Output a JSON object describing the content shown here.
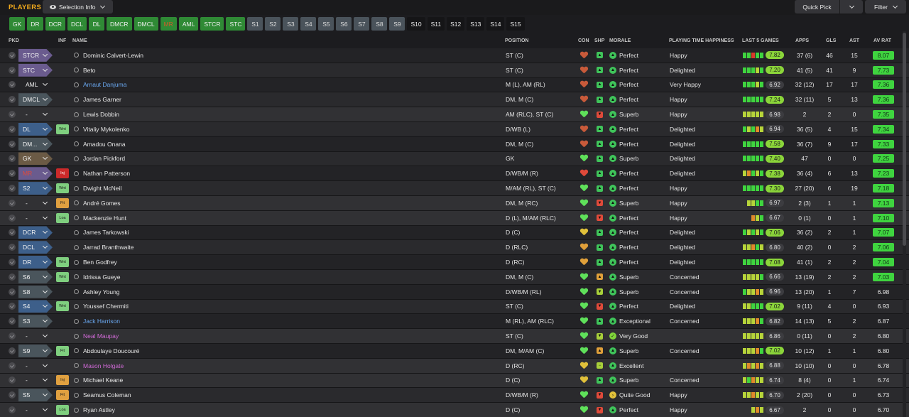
{
  "header": {
    "title": "PLAYERS",
    "selection_info": "Selection Info",
    "quick_pick": "Quick Pick",
    "filter": "Filter"
  },
  "positions": [
    {
      "label": "GK",
      "style": "green"
    },
    {
      "label": "DR",
      "style": "green"
    },
    {
      "label": "DCR",
      "style": "green"
    },
    {
      "label": "DCL",
      "style": "green"
    },
    {
      "label": "DL",
      "style": "green"
    },
    {
      "label": "DMCR",
      "style": "green"
    },
    {
      "label": "DMCL",
      "style": "green"
    },
    {
      "label": "MR",
      "style": "empty"
    },
    {
      "label": "AML",
      "style": "green"
    },
    {
      "label": "STCR",
      "style": "green"
    },
    {
      "label": "STC",
      "style": "green"
    },
    {
      "label": "S1",
      "style": "grey"
    },
    {
      "label": "S2",
      "style": "grey"
    },
    {
      "label": "S3",
      "style": "grey"
    },
    {
      "label": "S4",
      "style": "grey"
    },
    {
      "label": "S5",
      "style": "grey"
    },
    {
      "label": "S6",
      "style": "grey"
    },
    {
      "label": "S7",
      "style": "grey"
    },
    {
      "label": "S8",
      "style": "grey"
    },
    {
      "label": "S9",
      "style": "grey"
    },
    {
      "label": "S10",
      "style": "dark"
    },
    {
      "label": "S11",
      "style": "dark"
    },
    {
      "label": "S12",
      "style": "dark"
    },
    {
      "label": "S13",
      "style": "dark"
    },
    {
      "label": "S14",
      "style": "dark"
    },
    {
      "label": "S15",
      "style": "dark"
    }
  ],
  "columns": {
    "pkd": "PKD",
    "inf": "INF",
    "name": "NAME",
    "position": "POSITION",
    "con": "CON",
    "shp": "SHP",
    "morale": "MORALE",
    "playing_time": "PLAYING TIME HAPPINESS",
    "last5": "LAST 5 GAMES",
    "apps": "APPS",
    "gls": "GLS",
    "ast": "AST",
    "av_rat": "AV RAT"
  },
  "colors": {
    "accent": "#f0a91c",
    "good": "#3fd43f",
    "name_link": "#6aa8f0",
    "name_loan": "#d06ad6"
  },
  "players": [
    {
      "slot": "STCR",
      "slot_color": "#6a5b8e",
      "inf": "",
      "name": "Dominic Calvert-Lewin",
      "name_color": "",
      "pos": "ST (C)",
      "con": "#c85a3a",
      "shp": "#3fc45a",
      "shp_mark": "▲",
      "morale_color": "#3fc45a",
      "morale_mark": "▲",
      "morale": "Perfect",
      "pt": "Happy",
      "l5": "ggrgg",
      "l5_rating": "7.82",
      "l5_good": true,
      "apps": "37 (6)",
      "gls": "46",
      "ast": "15",
      "av": "8.07",
      "av_good": true
    },
    {
      "slot": "STC",
      "slot_color": "#6a5b8e",
      "inf": "",
      "name": "Beto",
      "name_color": "",
      "pos": "ST (C)",
      "con": "#c85a3a",
      "shp": "#3fc45a",
      "shp_mark": "▲",
      "morale_color": "#3fc45a",
      "morale_mark": "▲",
      "morale": "Perfect",
      "pt": "Delighted",
      "l5": "gggyg",
      "l5_rating": "7.20",
      "l5_good": true,
      "apps": "41 (5)",
      "gls": "41",
      "ast": "9",
      "av": "7.73",
      "av_good": true
    },
    {
      "slot": "AML",
      "slot_color": "",
      "inf": "",
      "name": "Arnaut Danjuma",
      "name_color": "#6aa8f0",
      "pos": "M (L), AM (RL)",
      "con": "#c85a3a",
      "shp": "#3fc45a",
      "shp_mark": "▲",
      "morale_color": "#3fc45a",
      "morale_mark": "▲",
      "morale": "Perfect",
      "pt": "Very Happy",
      "l5": "gggyg",
      "l5_rating": "6.92",
      "l5_good": false,
      "apps": "32 (12)",
      "gls": "17",
      "ast": "17",
      "av": "7.36",
      "av_good": true
    },
    {
      "slot": "DMCL",
      "slot_color": "#4a555c",
      "inf": "",
      "name": "James Garner",
      "name_color": "",
      "pos": "DM, M (C)",
      "con": "#c85a3a",
      "shp": "#3fc45a",
      "shp_mark": "▲",
      "morale_color": "#3fc45a",
      "morale_mark": "▲",
      "morale": "Perfect",
      "pt": "Happy",
      "l5": "ggggg",
      "l5_rating": "7.24",
      "l5_good": true,
      "apps": "32 (11)",
      "gls": "5",
      "ast": "13",
      "av": "7.36",
      "av_good": true
    },
    {
      "slot": "-",
      "slot_color": "",
      "inf": "",
      "name": "Lewis Dobbin",
      "name_color": "",
      "pos": "AM (RLC), ST (C)",
      "con": "#5fe05a",
      "shp": "#e04a3a",
      "shp_mark": "▼",
      "morale_color": "#3fc45a",
      "morale_mark": "▲",
      "morale": "Superb",
      "pt": "Happy",
      "l5": "yyyyy",
      "l5_rating": "6.98",
      "l5_good": false,
      "apps": "2",
      "gls": "2",
      "ast": "0",
      "av": "7.35",
      "av_good": true
    },
    {
      "slot": "DL",
      "slot_color": "#3d5f8a",
      "inf": "Wnt",
      "inf_color": "#7fcf7f",
      "name": "Vitaliy Mykolenko",
      "name_color": "",
      "pos": "D/WB (L)",
      "con": "#c85a3a",
      "shp": "#3fc45a",
      "shp_mark": "▲",
      "morale_color": "#3fc45a",
      "morale_mark": "▲",
      "morale": "Perfect",
      "pt": "Delighted",
      "l5": "gygoy",
      "l5_rating": "6.94",
      "l5_good": false,
      "apps": "36 (5)",
      "gls": "4",
      "ast": "15",
      "av": "7.34",
      "av_good": true
    },
    {
      "slot": "DM...",
      "slot_color": "#4a555c",
      "inf": "",
      "name": "Amadou Onana",
      "name_color": "",
      "pos": "DM, M (C)",
      "con": "#c85a3a",
      "shp": "#3fc45a",
      "shp_mark": "▲",
      "morale_color": "#3fc45a",
      "morale_mark": "▲",
      "morale": "Perfect",
      "pt": "Delighted",
      "l5": "ggggg",
      "l5_rating": "7.58",
      "l5_good": true,
      "apps": "36 (7)",
      "gls": "9",
      "ast": "17",
      "av": "7.33",
      "av_good": true
    },
    {
      "slot": "GK",
      "slot_color": "#6b5a45",
      "inf": "",
      "name": "Jordan Pickford",
      "name_color": "",
      "pos": "GK",
      "con": "#5fe05a",
      "shp": "#3fc45a",
      "shp_mark": "▲",
      "morale_color": "#3fc45a",
      "morale_mark": "▲",
      "morale": "Superb",
      "pt": "Delighted",
      "l5": "ggggg",
      "l5_rating": "7.40",
      "l5_good": true,
      "apps": "47",
      "gls": "0",
      "ast": "0",
      "av": "7.25",
      "av_good": true
    },
    {
      "slot": "MR",
      "slot_color": "#6a5b8e",
      "slot_text_color": "#e04a3a",
      "inf": "Inj",
      "inf_color": "#cc2a2a",
      "name": "Nathan Patterson",
      "name_color": "",
      "pos": "D/WB/M (R)",
      "con": "#e04a3a",
      "shp": "#3fc45a",
      "shp_mark": "▲",
      "morale_color": "#3fc45a",
      "morale_mark": "▲",
      "morale": "Perfect",
      "pt": "Delighted",
      "l5": "yogyg",
      "l5_rating": "7.38",
      "l5_good": true,
      "apps": "36 (4)",
      "gls": "6",
      "ast": "13",
      "av": "7.23",
      "av_good": true
    },
    {
      "slot": "S2",
      "slot_color": "#3d5f8a",
      "inf": "Wnt",
      "inf_color": "#7fcf7f",
      "name": "Dwight McNeil",
      "name_color": "",
      "pos": "M/AM (RL), ST (C)",
      "con": "#5fe05a",
      "shp": "#3fc45a",
      "shp_mark": "▲",
      "morale_color": "#3fc45a",
      "morale_mark": "▲",
      "morale": "Perfect",
      "pt": "Happy",
      "l5": "ggggg",
      "l5_rating": "7.30",
      "l5_good": true,
      "apps": "27 (20)",
      "gls": "6",
      "ast": "19",
      "av": "7.18",
      "av_good": true
    },
    {
      "slot": "-",
      "slot_color": "",
      "inf": "Fit",
      "inf_color": "#e0a040",
      "name": "André Gomes",
      "name_color": "",
      "pos": "DM, M (RC)",
      "con": "#5fe05a",
      "shp": "#e04a3a",
      "shp_mark": "▼",
      "morale_color": "#3fc45a",
      "morale_mark": "▲",
      "morale": "Superb",
      "pt": "Happy",
      "l5": "_yygg",
      "l5_rating": "6.97",
      "l5_good": false,
      "apps": "2 (3)",
      "gls": "1",
      "ast": "1",
      "av": "7.13",
      "av_good": true
    },
    {
      "slot": "-",
      "slot_color": "",
      "inf": "Loa",
      "inf_color": "#7fcf7f",
      "name": "Mackenzie Hunt",
      "name_color": "",
      "pos": "D (L), M/AM (RLC)",
      "con": "#5fe05a",
      "shp": "#e04a3a",
      "shp_mark": "▼",
      "morale_color": "#3fc45a",
      "morale_mark": "▲",
      "morale": "Perfect",
      "pt": "Happy",
      "l5": "__oyg",
      "l5_rating": "6.67",
      "l5_good": false,
      "apps": "0 (1)",
      "gls": "0",
      "ast": "1",
      "av": "7.10",
      "av_good": true
    },
    {
      "slot": "DCR",
      "slot_color": "#3d5f8a",
      "inf": "",
      "name": "James Tarkowski",
      "name_color": "",
      "pos": "D (C)",
      "con": "#e0c03a",
      "shp": "#3fc45a",
      "shp_mark": "▲",
      "morale_color": "#3fc45a",
      "morale_mark": "▲",
      "morale": "Perfect",
      "pt": "Delighted",
      "l5": "gygyg",
      "l5_rating": "7.06",
      "l5_good": true,
      "apps": "36 (2)",
      "gls": "2",
      "ast": "1",
      "av": "7.07",
      "av_good": true
    },
    {
      "slot": "DCL",
      "slot_color": "#3d5f8a",
      "inf": "",
      "name": "Jarrad Branthwaite",
      "name_color": "",
      "pos": "D (RLC)",
      "con": "#e0a03a",
      "shp": "#3fc45a",
      "shp_mark": "▲",
      "morale_color": "#3fc45a",
      "morale_mark": "▲",
      "morale": "Perfect",
      "pt": "Delighted",
      "l5": "yyogy",
      "l5_rating": "6.80",
      "l5_good": false,
      "apps": "40 (2)",
      "gls": "0",
      "ast": "2",
      "av": "7.06",
      "av_good": true
    },
    {
      "slot": "DR",
      "slot_color": "#3d5f8a",
      "inf": "Wnt",
      "inf_color": "#7fcf7f",
      "name": "Ben Godfrey",
      "name_color": "",
      "pos": "D (RC)",
      "con": "#e0a03a",
      "shp": "#3fc45a",
      "shp_mark": "▲",
      "morale_color": "#3fc45a",
      "morale_mark": "▲",
      "morale": "Perfect",
      "pt": "Delighted",
      "l5": "ggggg",
      "l5_rating": "7.08",
      "l5_good": true,
      "apps": "41 (1)",
      "gls": "2",
      "ast": "2",
      "av": "7.04",
      "av_good": true
    },
    {
      "slot": "S6",
      "slot_color": "#4a555c",
      "inf": "Wnt",
      "inf_color": "#7fcf7f",
      "name": "Idrissa Gueye",
      "name_color": "",
      "pos": "DM, M (C)",
      "con": "#5fe05a",
      "shp": "#e0a03a",
      "shp_mark": "▲",
      "morale_color": "#3fc45a",
      "morale_mark": "▲",
      "morale": "Superb",
      "pt": "Concerned",
      "l5": "yyyyg",
      "l5_rating": "6.66",
      "l5_good": false,
      "apps": "13 (19)",
      "gls": "2",
      "ast": "2",
      "av": "7.03",
      "av_good": true
    },
    {
      "slot": "S8",
      "slot_color": "#4a555c",
      "inf": "",
      "name": "Ashley Young",
      "name_color": "",
      "pos": "D/WB/M (RL)",
      "con": "#5fe05a",
      "shp": "#a8d03a",
      "shp_mark": "▼",
      "morale_color": "#3fc45a",
      "morale_mark": "▲",
      "morale": "Superb",
      "pt": "Concerned",
      "l5": "gyyoy",
      "l5_rating": "6.96",
      "l5_good": false,
      "apps": "13 (20)",
      "gls": "1",
      "ast": "7",
      "av": "6.98",
      "av_good": false
    },
    {
      "slot": "S4",
      "slot_color": "#3d5f8a",
      "inf": "Wnt",
      "inf_color": "#7fcf7f",
      "name": "Youssef Chermiti",
      "name_color": "",
      "pos": "ST (C)",
      "con": "#5fe05a",
      "shp": "#e04a3a",
      "shp_mark": "▼",
      "morale_color": "#3fc45a",
      "morale_mark": "▲",
      "morale": "Perfect",
      "pt": "Delighted",
      "l5": "yyggg",
      "l5_rating": "7.02",
      "l5_good": true,
      "apps": "9 (11)",
      "gls": "4",
      "ast": "0",
      "av": "6.93",
      "av_good": false
    },
    {
      "slot": "S3",
      "slot_color": "#4a555c",
      "inf": "",
      "name": "Jack Harrison",
      "name_color": "#6aa8f0",
      "pos": "M (RL), AM (RLC)",
      "con": "#5fe05a",
      "shp": "#3fc45a",
      "shp_mark": "▲",
      "morale_color": "#3fc45a",
      "morale_mark": "▲",
      "morale": "Exceptional",
      "pt": "Concerned",
      "l5": "yyyog",
      "l5_rating": "6.82",
      "l5_good": false,
      "apps": "14 (13)",
      "gls": "5",
      "ast": "2",
      "av": "6.87",
      "av_good": false
    },
    {
      "slot": "-",
      "slot_color": "",
      "inf": "",
      "name": "Neal Maupay",
      "name_color": "#d06ad6",
      "pos": "ST (C)",
      "con": "#5fe05a",
      "shp": "#a8d03a",
      "shp_mark": "▼",
      "morale_color": "#7fd43a",
      "morale_mark": "✓",
      "morale": "Very Good",
      "pt": "",
      "l5": "yyyyy",
      "l5_rating": "6.86",
      "l5_good": false,
      "apps": "0 (11)",
      "gls": "0",
      "ast": "2",
      "av": "6.80",
      "av_good": false
    },
    {
      "slot": "S9",
      "slot_color": "#4a555c",
      "inf": "Fit",
      "inf_color": "#7fcf7f",
      "name": "Abdoulaye Doucouré",
      "name_color": "",
      "pos": "DM, M/AM (C)",
      "con": "#5fe05a",
      "shp": "#e0a03a",
      "shp_mark": "▲",
      "morale_color": "#3fc45a",
      "morale_mark": "▲",
      "morale": "Superb",
      "pt": "Concerned",
      "l5": "yyyog",
      "l5_rating": "7.02",
      "l5_good": true,
      "apps": "10 (12)",
      "gls": "1",
      "ast": "1",
      "av": "6.80",
      "av_good": false
    },
    {
      "slot": "-",
      "slot_color": "",
      "inf": "",
      "name": "Mason Holgate",
      "name_color": "#d06ad6",
      "pos": "D (RC)",
      "con": "#e0c03a",
      "shp": "#a8d03a",
      "shp_mark": "−",
      "morale_color": "#3fc45a",
      "morale_mark": "▲",
      "morale": "Excellent",
      "pt": "",
      "l5": "yoyoy",
      "l5_rating": "6.88",
      "l5_good": false,
      "apps": "10 (10)",
      "gls": "0",
      "ast": "0",
      "av": "6.78",
      "av_good": false
    },
    {
      "slot": "-",
      "slot_color": "",
      "inf": "Inj",
      "inf_color": "#e0a040",
      "name": "Michael Keane",
      "name_color": "",
      "pos": "D (C)",
      "con": "#e0c03a",
      "shp": "#3fc45a",
      "shp_mark": "▲",
      "morale_color": "#3fc45a",
      "morale_mark": "▲",
      "morale": "Superb",
      "pt": "Concerned",
      "l5": "ygoyy",
      "l5_rating": "6.74",
      "l5_good": false,
      "apps": "8 (4)",
      "gls": "0",
      "ast": "1",
      "av": "6.74",
      "av_good": false
    },
    {
      "slot": "S5",
      "slot_color": "#4a555c",
      "inf": "Fit",
      "inf_color": "#e0a040",
      "name": "Seamus Coleman",
      "name_color": "",
      "pos": "D/WB/M (R)",
      "con": "#5fe05a",
      "shp": "#e04a3a",
      "shp_mark": "▼",
      "morale_color": "#e0c03a",
      "morale_mark": "›",
      "morale": "Quite Good",
      "pt": "Happy",
      "l5": "yyoyy",
      "l5_rating": "6.70",
      "l5_good": false,
      "apps": "2 (20)",
      "gls": "0",
      "ast": "0",
      "av": "6.73",
      "av_good": false
    },
    {
      "slot": "-",
      "slot_color": "",
      "inf": "Loa",
      "inf_color": "#7fcf7f",
      "name": "Ryan Astley",
      "name_color": "",
      "pos": "D (C)",
      "con": "#5fe05a",
      "shp": "#e04a3a",
      "shp_mark": "▼",
      "morale_color": "#3fc45a",
      "morale_mark": "▲",
      "morale": "Perfect",
      "pt": "Happy",
      "l5": "__yoy",
      "l5_rating": "6.67",
      "l5_good": false,
      "apps": "2",
      "gls": "0",
      "ast": "0",
      "av": "6.70",
      "av_good": false
    }
  ]
}
